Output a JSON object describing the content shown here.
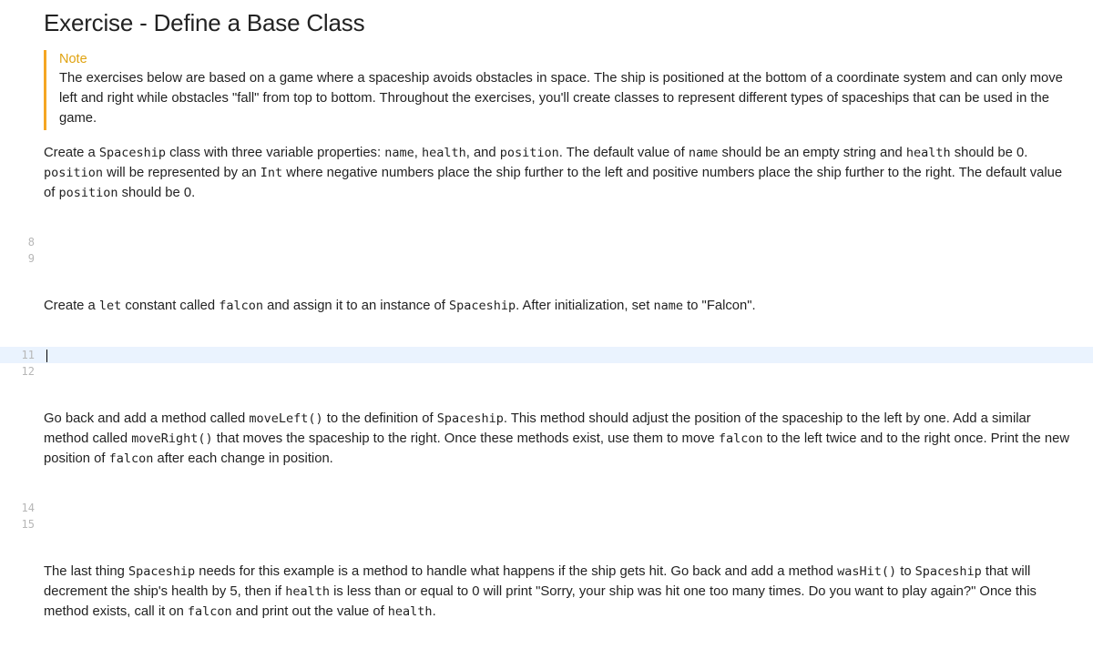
{
  "title": "Exercise - Define a Base Class",
  "note": {
    "label": "Note",
    "text_parts": [
      "The exercises below are based on a game where a spaceship avoids obstacles in space. The ship is positioned at the bottom of a coordinate system and can only move left and right while obstacles \"fall\" from top to bottom. Throughout the exercises, you'll create classes to represent different types of spaceships that can be used in the game."
    ]
  },
  "para1": {
    "segments": [
      {
        "t": "Create a "
      },
      {
        "c": "Spaceship"
      },
      {
        "t": " class with three variable properties: "
      },
      {
        "c": "name"
      },
      {
        "t": ", "
      },
      {
        "c": "health"
      },
      {
        "t": ", and "
      },
      {
        "c": "position"
      },
      {
        "t": ". The default value of "
      },
      {
        "c": "name"
      },
      {
        "t": " should be an empty string and "
      },
      {
        "c": "health"
      },
      {
        "t": " should be 0. "
      },
      {
        "c": "position"
      },
      {
        "t": " will be represented by an "
      },
      {
        "c": "Int"
      },
      {
        "t": " where negative numbers place the ship further to the left and positive numbers place the ship further to the right. The default value of "
      },
      {
        "c": "position"
      },
      {
        "t": " should be 0."
      }
    ]
  },
  "codeblock1": {
    "lines": [
      "8",
      "9"
    ]
  },
  "para2": {
    "segments": [
      {
        "t": "Create a "
      },
      {
        "c": "let"
      },
      {
        "t": " constant called "
      },
      {
        "c": "falcon"
      },
      {
        "t": " and assign it to an instance of "
      },
      {
        "c": "Spaceship"
      },
      {
        "t": ". After initialization, set "
      },
      {
        "c": "name"
      },
      {
        "t": " to \"Falcon\"."
      }
    ]
  },
  "codeblock2": {
    "lines": [
      "11",
      "12"
    ],
    "active_index": 0
  },
  "para3": {
    "segments": [
      {
        "t": "Go back and add a method called "
      },
      {
        "c": "moveLeft()"
      },
      {
        "t": " to the definition of "
      },
      {
        "c": "Spaceship"
      },
      {
        "t": ". This method should adjust the position of the spaceship to the left by one. Add a similar method called "
      },
      {
        "c": "moveRight()"
      },
      {
        "t": " that moves the spaceship to the right. Once these methods exist, use them to move "
      },
      {
        "c": "falcon"
      },
      {
        "t": " to the left twice and to the right once. Print the new position of "
      },
      {
        "c": "falcon"
      },
      {
        "t": " after each change in position."
      }
    ]
  },
  "codeblock3": {
    "lines": [
      "14",
      "15"
    ]
  },
  "para4": {
    "segments": [
      {
        "t": "The last thing "
      },
      {
        "c": "Spaceship"
      },
      {
        "t": " needs for this example is a method to handle what happens if the ship gets hit. Go back and add a method "
      },
      {
        "c": "wasHit()"
      },
      {
        "t": " to "
      },
      {
        "c": "Spaceship"
      },
      {
        "t": " that will decrement the ship's health by 5, then if "
      },
      {
        "c": "health"
      },
      {
        "t": " is less than or equal to 0 will print \"Sorry, your ship was hit one too many times. Do you want to play again?\" Once this method exists, call it on "
      },
      {
        "c": "falcon"
      },
      {
        "t": " and print out the value of "
      },
      {
        "c": "health"
      },
      {
        "t": "."
      }
    ]
  }
}
